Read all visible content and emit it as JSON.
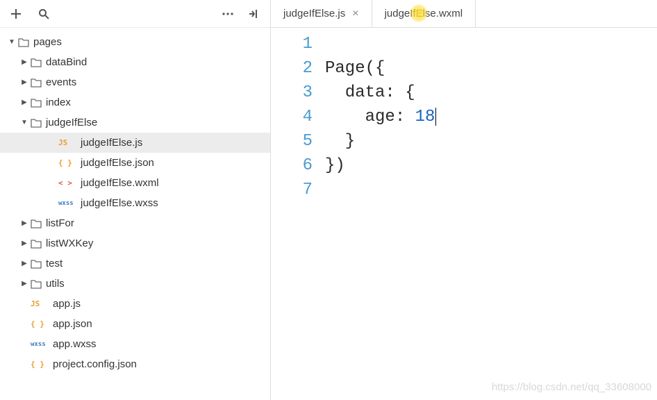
{
  "toolbar": {
    "addTooltip": "New",
    "searchTooltip": "Search",
    "moreTooltip": "More",
    "collapseTooltip": "Collapse"
  },
  "tree": {
    "root": {
      "name": "pages",
      "expanded": true,
      "children": [
        {
          "name": "dataBind",
          "type": "folder",
          "expanded": false
        },
        {
          "name": "events",
          "type": "folder",
          "expanded": false
        },
        {
          "name": "index",
          "type": "folder",
          "expanded": false
        },
        {
          "name": "judgeIfElse",
          "type": "folder",
          "expanded": true,
          "children": [
            {
              "name": "judgeIfElse.js",
              "type": "file",
              "icon": "js",
              "active": true
            },
            {
              "name": "judgeIfElse.json",
              "type": "file",
              "icon": "json"
            },
            {
              "name": "judgeIfElse.wxml",
              "type": "file",
              "icon": "wxml"
            },
            {
              "name": "judgeIfElse.wxss",
              "type": "file",
              "icon": "wxss"
            }
          ]
        },
        {
          "name": "listFor",
          "type": "folder",
          "expanded": false
        },
        {
          "name": "listWXKey",
          "type": "folder",
          "expanded": false
        },
        {
          "name": "test",
          "type": "folder",
          "expanded": false
        },
        {
          "name": "utils",
          "type": "folder",
          "expanded": false
        },
        {
          "name": "app.js",
          "type": "file",
          "icon": "js"
        },
        {
          "name": "app.json",
          "type": "file",
          "icon": "json"
        },
        {
          "name": "app.wxss",
          "type": "file",
          "icon": "wxss"
        },
        {
          "name": "project.config.json",
          "type": "file",
          "icon": "json"
        }
      ]
    }
  },
  "tabs": [
    {
      "label": "judgeIfElse.js",
      "active": true,
      "closable": true
    },
    {
      "label": "judgeIfElse.wxml",
      "active": false,
      "closable": false,
      "cursorHighlight": true
    }
  ],
  "code": {
    "lines": [
      [
        {
          "t": "",
          "cls": ""
        }
      ],
      [
        {
          "t": "Page",
          "cls": "tok-ident"
        },
        {
          "t": "({",
          "cls": "tok-punc"
        }
      ],
      [
        {
          "t": "  ",
          "cls": ""
        },
        {
          "t": "data",
          "cls": "tok-key"
        },
        {
          "t": ": {",
          "cls": "tok-punc"
        }
      ],
      [
        {
          "t": "    ",
          "cls": ""
        },
        {
          "t": "age",
          "cls": "tok-key"
        },
        {
          "t": ": ",
          "cls": "tok-punc"
        },
        {
          "t": "18",
          "cls": "tok-num",
          "caretAfter": true
        }
      ],
      [
        {
          "t": "  }",
          "cls": "tok-punc"
        }
      ],
      [
        {
          "t": "})",
          "cls": "tok-punc"
        }
      ],
      [
        {
          "t": "",
          "cls": ""
        }
      ]
    ]
  },
  "watermark": "https://blog.csdn.net/qq_33608000",
  "fileIconGlyphs": {
    "js": "JS",
    "json": "{ }",
    "wxml": "< >",
    "wxss": "wxss"
  }
}
